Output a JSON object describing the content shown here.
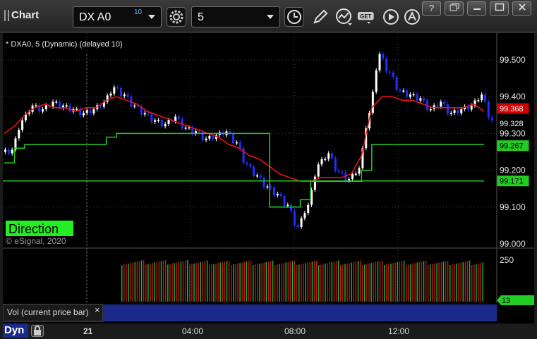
{
  "app": {
    "title": "Chart"
  },
  "toolbar": {
    "symbol": "DX A0",
    "symbol_badge": "10",
    "interval": "5",
    "icons": [
      "settings-gear-icon",
      "clock-icon",
      "pencil-icon",
      "study-icon",
      "get-icon",
      "play-icon",
      "alert-icon"
    ]
  },
  "window_controls": [
    "?",
    "restore",
    "minimize",
    "maximize",
    "close"
  ],
  "chart": {
    "header": "* DXA0, 5 (Dynamic) (delayed 10)",
    "direction_label": "Direction",
    "copyright": "© eSignal, 2020",
    "price_axis": [
      "99.500",
      "99.400",
      "99.300",
      "99.200",
      "99.100",
      "99.000"
    ],
    "price_tags": [
      {
        "value": "99.368",
        "color": "#d00000",
        "text_color": "#ffffff"
      },
      {
        "value": "99.328",
        "color": "#000000",
        "text_color": "#ffffff"
      },
      {
        "value": "99.267",
        "color": "#22cc22",
        "text_color": "#000000"
      },
      {
        "value": "99.171",
        "color": "#22cc22",
        "text_color": "#000000"
      }
    ],
    "volume_axis": [
      "250"
    ],
    "volume_tag": "13",
    "volume_panel_label": "Vol (current price bar)",
    "volume_close": "×",
    "time_axis": [
      "21",
      "04:00",
      "08:00",
      "12:00"
    ],
    "dyn_label": "Dyn",
    "colors": {
      "up": "#ffffff",
      "down": "#1f2fff",
      "fast_ma": "#ff1010",
      "slow_ma": "#22cc22",
      "direction": "#22ee22"
    }
  },
  "chart_data": {
    "type": "line",
    "title": "* DXA0, 5 (Dynamic) (delayed 10)",
    "ylim": [
      99.0,
      99.55
    ],
    "series": [
      {
        "values": [
          99.25,
          99.33,
          99.37,
          99.36,
          99.38,
          99.37,
          99.36,
          99.35,
          99.36,
          99.38,
          99.42,
          99.4,
          99.37,
          99.35,
          99.33,
          99.32,
          99.34,
          99.31,
          99.3,
          99.28,
          99.29,
          99.3,
          99.27,
          99.21,
          99.18,
          99.15,
          99.13,
          99.1,
          99.04,
          99.1,
          99.21,
          99.24,
          99.19,
          99.17,
          99.2,
          99.35,
          99.51,
          99.46,
          99.41,
          99.4,
          99.39,
          99.36,
          99.38,
          99.35,
          99.36,
          99.37,
          99.4,
          99.33
        ]
      },
      {
        "values": [
          99.3,
          99.32,
          99.35,
          99.37,
          99.38,
          99.37,
          99.37,
          99.36,
          99.37,
          99.37,
          99.39,
          99.4,
          99.39,
          99.38,
          99.36,
          99.35,
          99.34,
          99.33,
          99.32,
          99.31,
          99.3,
          99.29,
          99.27,
          99.26,
          99.24,
          99.23,
          99.21,
          99.19,
          99.18,
          99.17,
          99.17,
          99.18,
          99.18,
          99.18,
          99.19,
          99.24,
          99.37,
          99.4,
          99.4,
          99.39,
          99.39,
          99.38,
          99.37,
          99.37,
          99.37,
          99.37,
          99.38,
          99.36
        ]
      },
      {
        "values": [
          99.22,
          99.26,
          99.27,
          99.27,
          99.27,
          99.27,
          99.27,
          99.27,
          99.27,
          99.27,
          99.29,
          99.3,
          99.3,
          99.3,
          99.3,
          99.3,
          99.3,
          99.3,
          99.3,
          99.3,
          99.3,
          99.3,
          99.3,
          99.3,
          99.3,
          99.3,
          99.1,
          99.1,
          99.1,
          99.12,
          99.17,
          99.17,
          99.17,
          99.17,
          99.17,
          99.2,
          99.27,
          99.27,
          99.27,
          99.27,
          99.27,
          99.27,
          99.27,
          99.27,
          99.27,
          99.27,
          99.27,
          99.27
        ]
      },
      {
        "values": [
          99.171
        ]
      }
    ]
  }
}
